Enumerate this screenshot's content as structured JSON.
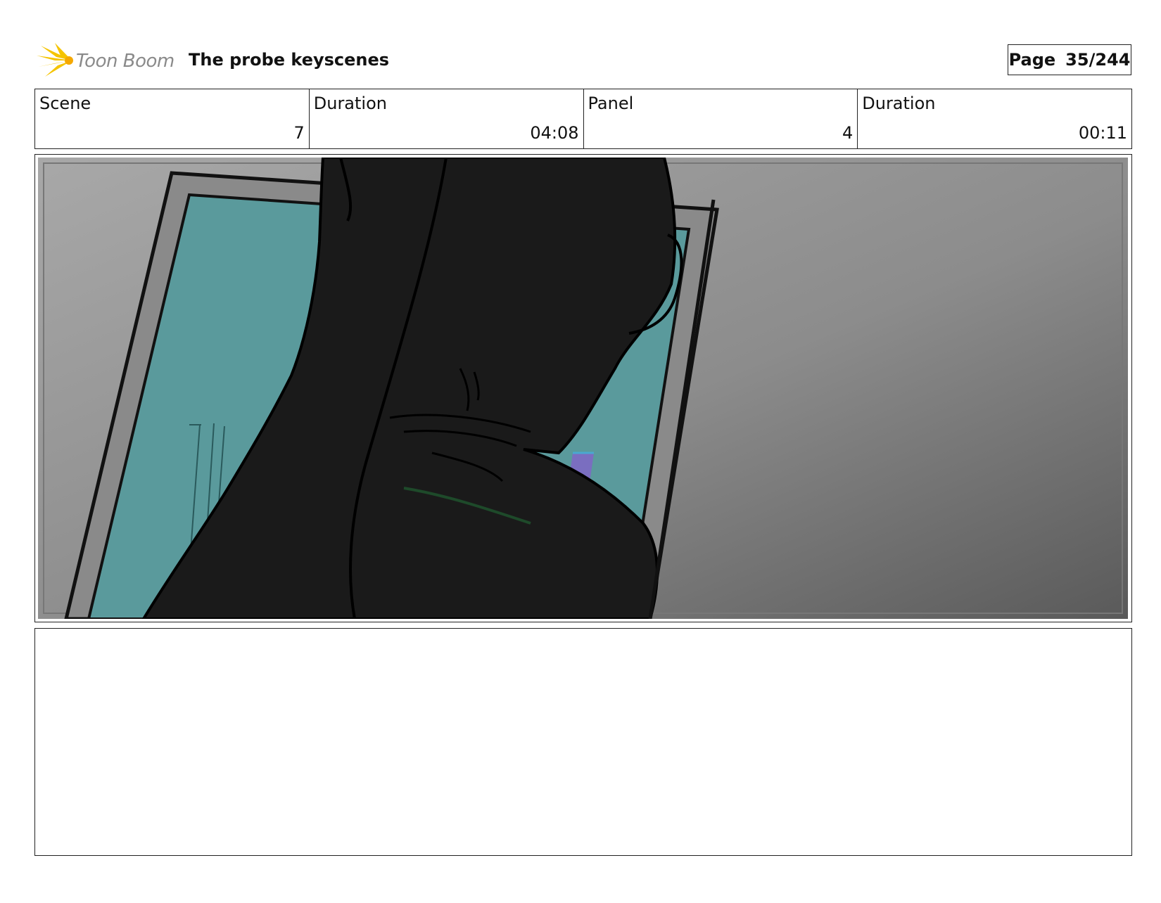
{
  "header": {
    "logo_text": "Toon Boom",
    "title": "The probe keyscenes",
    "page_label": "Page",
    "page_value": "35/244"
  },
  "info": [
    {
      "label": "Scene",
      "value": "7"
    },
    {
      "label": "Duration",
      "value": "04:08"
    },
    {
      "label": "Panel",
      "value": "4"
    },
    {
      "label": "Duration",
      "value": "00:11"
    }
  ],
  "notes": {
    "text": ""
  },
  "colors": {
    "window_glass": "#5a9a9c",
    "silhouette": "#1a1a1a",
    "pillar": "#7a6ec0",
    "wall_light": "#a8a8a8",
    "wall_dark": "#5a5a5a",
    "logo_yellow": "#f5c400"
  }
}
